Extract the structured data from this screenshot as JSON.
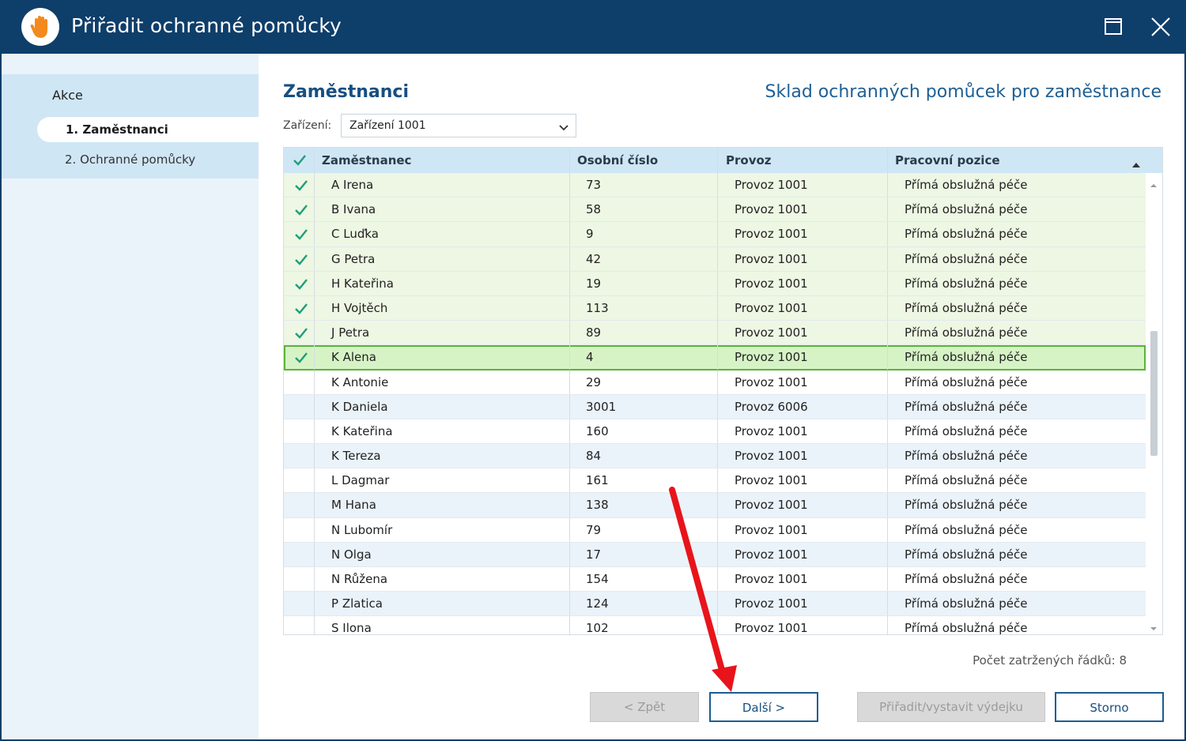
{
  "window": {
    "title": "Přiřadit ochranné pomůcky",
    "icon": "hand-icon",
    "maximize_icon": "maximize-icon",
    "close_icon": "close-icon"
  },
  "sidebar": {
    "heading": "Akce",
    "items": [
      {
        "label": "1. Zaměstnanci",
        "active": true
      },
      {
        "label": "2. Ochranné pomůcky",
        "active": false
      }
    ]
  },
  "main": {
    "title": "Zaměstnanci",
    "subtitle": "Sklad ochranných pomůcek pro zaměstnance",
    "filter": {
      "label": "Zařízení:",
      "value": "Zařízení 1001"
    }
  },
  "grid": {
    "columns": [
      "Zaměstnanec",
      "Osobní číslo",
      "Provoz",
      "Pracovní pozice"
    ],
    "rows": [
      {
        "checked": true,
        "name": "A Irena",
        "number": "73",
        "provoz": "Provoz 1001",
        "pozice": "Přímá obslužná péče"
      },
      {
        "checked": true,
        "name": "B Ivana",
        "number": "58",
        "provoz": "Provoz 1001",
        "pozice": "Přímá obslužná péče"
      },
      {
        "checked": true,
        "name": "C Luďka",
        "number": "9",
        "provoz": "Provoz 1001",
        "pozice": "Přímá obslužná péče"
      },
      {
        "checked": true,
        "name": "G Petra",
        "number": "42",
        "provoz": "Provoz 1001",
        "pozice": "Přímá obslužná péče"
      },
      {
        "checked": true,
        "name": "H Kateřina",
        "number": "19",
        "provoz": "Provoz 1001",
        "pozice": "Přímá obslužná péče"
      },
      {
        "checked": true,
        "name": "H Vojtěch",
        "number": "113",
        "provoz": "Provoz 1001",
        "pozice": "Přímá obslužná péče"
      },
      {
        "checked": true,
        "name": "J Petra",
        "number": "89",
        "provoz": "Provoz 1001",
        "pozice": "Přímá obslužná péče"
      },
      {
        "checked": true,
        "selected": true,
        "name": "K Alena",
        "number": "4",
        "provoz": "Provoz 1001",
        "pozice": "Přímá obslužná péče"
      },
      {
        "checked": false,
        "name": "K Antonie",
        "number": "29",
        "provoz": "Provoz 1001",
        "pozice": "Přímá obslužná péče"
      },
      {
        "checked": false,
        "name": "K Daniela",
        "number": "3001",
        "provoz": "Provoz 6006",
        "pozice": "Přímá obslužná péče"
      },
      {
        "checked": false,
        "name": "K Kateřina",
        "number": "160",
        "provoz": "Provoz 1001",
        "pozice": "Přímá obslužná péče"
      },
      {
        "checked": false,
        "name": "K Tereza",
        "number": "84",
        "provoz": "Provoz 1001",
        "pozice": "Přímá obslužná péče"
      },
      {
        "checked": false,
        "name": "L Dagmar",
        "number": "161",
        "provoz": "Provoz 1001",
        "pozice": "Přímá obslužná péče"
      },
      {
        "checked": false,
        "name": "M Hana",
        "number": "138",
        "provoz": "Provoz 1001",
        "pozice": "Přímá obslužná péče"
      },
      {
        "checked": false,
        "name": "N Lubomír",
        "number": "79",
        "provoz": "Provoz 1001",
        "pozice": "Přímá obslužná péče"
      },
      {
        "checked": false,
        "name": "N Olga",
        "number": "17",
        "provoz": "Provoz 1001",
        "pozice": "Přímá obslužná péče"
      },
      {
        "checked": false,
        "name": "N Růžena",
        "number": "154",
        "provoz": "Provoz 1001",
        "pozice": "Přímá obslužná péče"
      },
      {
        "checked": false,
        "name": "P Zlatica",
        "number": "124",
        "provoz": "Provoz 1001",
        "pozice": "Přímá obslužná péče"
      },
      {
        "checked": false,
        "name": "S Ilona",
        "number": "102",
        "provoz": "Provoz 1001",
        "pozice": "Přímá obslužná péče"
      }
    ],
    "checked_count_text": "Počet zatržených řádků: 8"
  },
  "buttons": {
    "back": "< Zpět",
    "next": "Další >",
    "assign": "Přiřadit/vystavit výdejku",
    "cancel": "Storno"
  },
  "colors": {
    "titlebar": "#0e3e6a",
    "accent": "#174f80",
    "check": "#1f9e7a",
    "annotation_arrow": "#e8141b"
  }
}
